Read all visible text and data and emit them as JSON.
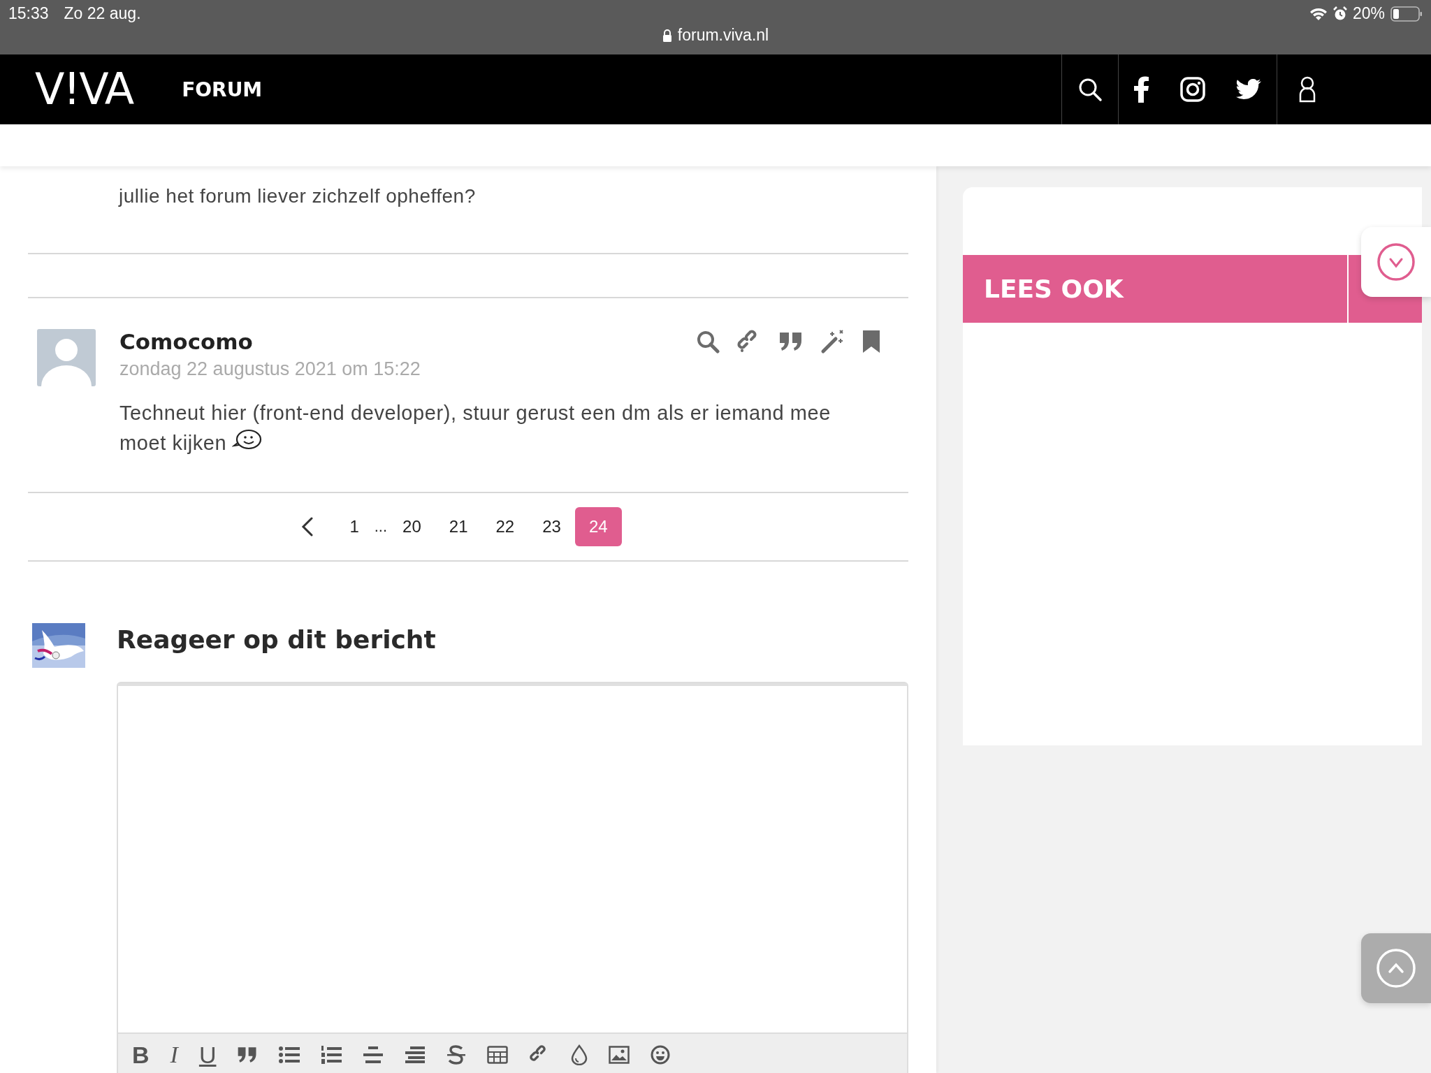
{
  "status_bar": {
    "time": "15:33",
    "date": "Zo 22 aug.",
    "battery": "20%"
  },
  "address_bar": {
    "url": "forum.viva.nl"
  },
  "nav": {
    "logo": "V!VA",
    "section": "FORUM"
  },
  "previous_post": {
    "lines": [
      "jullie het forum liever zichzelf opheffen?"
    ]
  },
  "post": {
    "author": "Comocomo",
    "date": "zondag 22 augustus 2021 om 15:22",
    "body": "Techneut hier (front-end developer), stuur gerust een dm als er iemand mee moet kijken"
  },
  "pagination": [
    {
      "kind": "page",
      "label": "1",
      "selected": false
    },
    {
      "kind": "gap",
      "label": "..."
    },
    {
      "kind": "page",
      "label": "20",
      "selected": false
    },
    {
      "kind": "page",
      "label": "21",
      "selected": false
    },
    {
      "kind": "page",
      "label": "22",
      "selected": false
    },
    {
      "kind": "page",
      "label": "23",
      "selected": false
    },
    {
      "kind": "page",
      "label": "24",
      "selected": true
    }
  ],
  "reply": {
    "heading": "Reageer op dit bericht"
  },
  "editor_toolbar": {
    "text_buttons": [
      {
        "label": "B",
        "kind": "bold"
      },
      {
        "label": "I",
        "kind": "italic"
      },
      {
        "label": "U",
        "kind": "underline"
      }
    ]
  },
  "sidebar": {
    "heading": "LEES OOK"
  }
}
